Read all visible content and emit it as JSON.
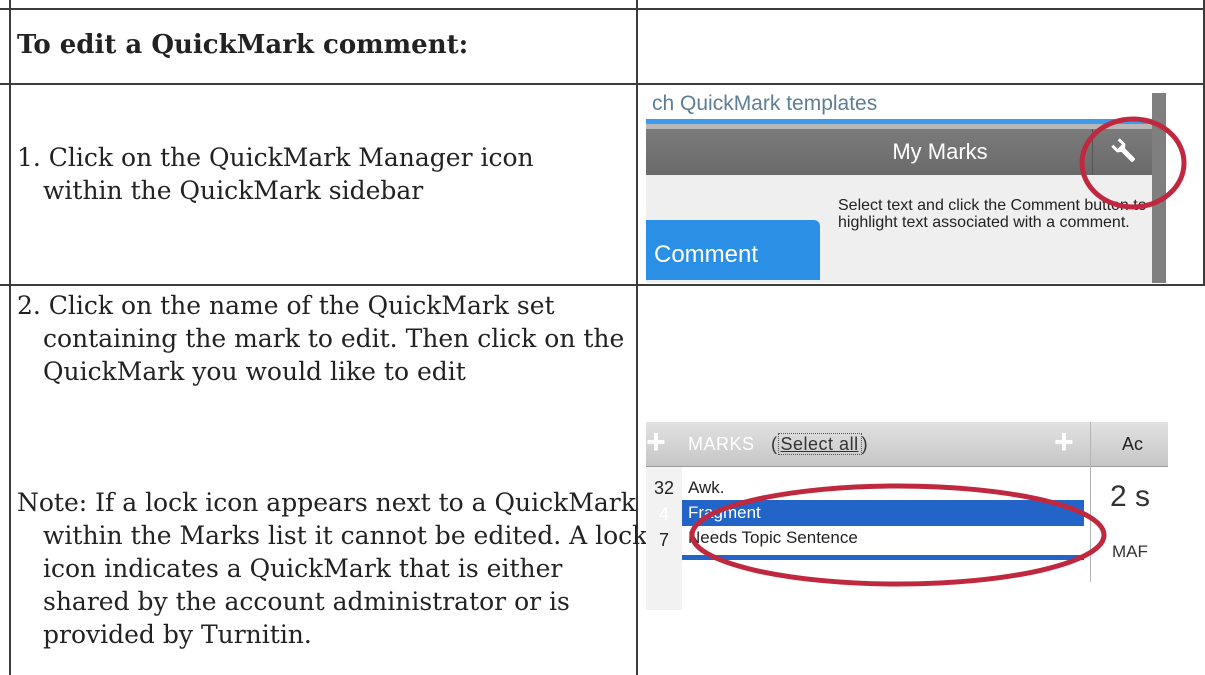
{
  "table": {
    "header": "To edit a QuickMark comment:",
    "step1": "1. Click on the QuickMark Manager icon within the QuickMark sidebar",
    "step2": "2. Click on the name of the QuickMark set containing the mark to edit. Then click on the QuickMark you would like to edit",
    "note": "Note: If a lock icon appears next to a QuickMark within the Marks list it cannot be edited. A lock icon indicates a QuickMark that is either shared by the account administrator or is provided by Turnitin."
  },
  "screenshot1": {
    "search_text": "ch QuickMark templates",
    "tab_label": "My Marks",
    "help_text": "Select text and click the Comment button to highlight text associated with a comment.",
    "comment_button": "Comment",
    "icon": "wrench-icon",
    "highlight_color": "#c0283f"
  },
  "screenshot2": {
    "marks_label": "MARKS",
    "select_all": "Select all",
    "column2_label": "Ac",
    "rows": [
      {
        "count": "32",
        "name": "Awk."
      },
      {
        "count": "4",
        "name": "Fragment"
      },
      {
        "count": "7",
        "name": "Needs Topic Sentence"
      }
    ],
    "side_value": "2 s",
    "side_label": "MAF",
    "highlight_color": "#c0283f"
  }
}
